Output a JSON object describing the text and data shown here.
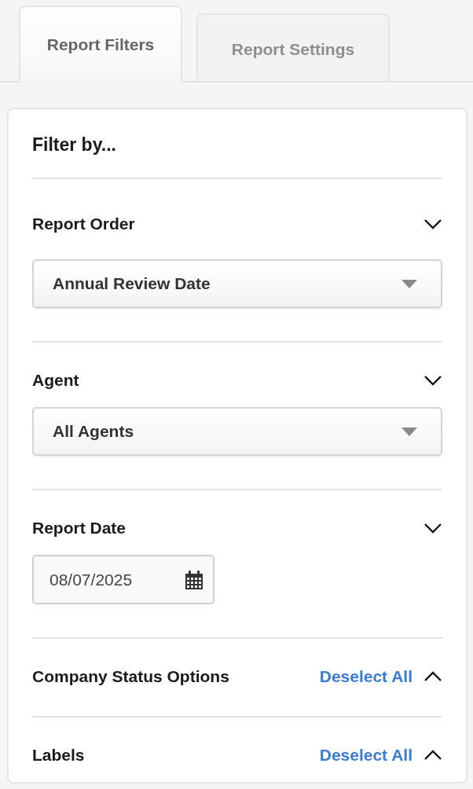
{
  "tabs": [
    {
      "label": "Report Filters",
      "selected": true
    },
    {
      "label": "Report Settings",
      "selected": false
    }
  ],
  "panel": {
    "heading": "Filter by...",
    "sections": [
      {
        "kind": "select",
        "title": "Report Order",
        "expanded": true,
        "value": "Annual Review Date"
      },
      {
        "kind": "select",
        "title": "Agent",
        "expanded": true,
        "value": "All Agents"
      },
      {
        "kind": "date",
        "title": "Report Date",
        "expanded": true,
        "value": "08/07/2025"
      },
      {
        "kind": "checklist",
        "title": "Company Status Options",
        "expanded": false,
        "action": "Deselect All"
      },
      {
        "kind": "checklist",
        "title": "Labels",
        "expanded": false,
        "action": "Deselect All"
      }
    ]
  }
}
